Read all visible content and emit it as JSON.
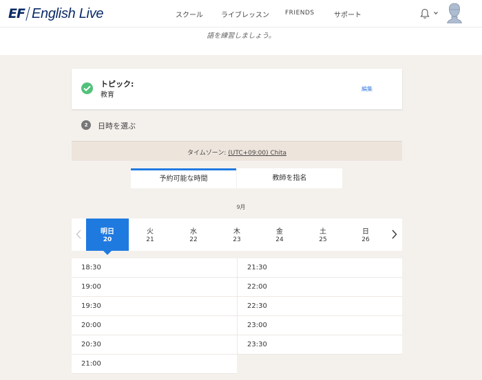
{
  "header": {
    "logo_mark": "EF",
    "logo_text": "English Live",
    "nav": [
      {
        "label": "スクール"
      },
      {
        "label": "ライブレッスン"
      },
      {
        "label": "FRIENDS"
      },
      {
        "label": "サポート"
      }
    ],
    "icons": [
      "bell-icon",
      "chevron-down-icon",
      "avatar"
    ]
  },
  "subheader": {
    "text": "語を練習しましょう。"
  },
  "topic": {
    "label": "トピック:",
    "value": "教育",
    "edit_label": "編集",
    "status_color": "#52c17a"
  },
  "step2": {
    "number": "2",
    "label": "日時を選ぶ"
  },
  "timezone": {
    "prefix": "タイムゾーン: ",
    "value": "(UTC+09:00) Chita"
  },
  "tabs": [
    {
      "label": "予約可能な時間",
      "active": true
    },
    {
      "label": "教師を指名",
      "active": false
    }
  ],
  "month": "9月",
  "days": [
    {
      "name": "明日",
      "num": "20",
      "selected": true
    },
    {
      "name": "火",
      "num": "21",
      "selected": false
    },
    {
      "name": "水",
      "num": "22",
      "selected": false
    },
    {
      "name": "木",
      "num": "23",
      "selected": false
    },
    {
      "name": "金",
      "num": "24",
      "selected": false
    },
    {
      "name": "土",
      "num": "25",
      "selected": false
    },
    {
      "name": "日",
      "num": "26",
      "selected": false
    }
  ],
  "slots_left": [
    "18:30",
    "19:00",
    "19:30",
    "20:00",
    "20:30",
    "21:00"
  ],
  "slots_right": [
    "21:30",
    "22:00",
    "22:30",
    "23:00",
    "23:30"
  ],
  "colors": {
    "accent": "#1f7ae0",
    "brand": "#0a2a66",
    "background": "#f4f1ed"
  }
}
